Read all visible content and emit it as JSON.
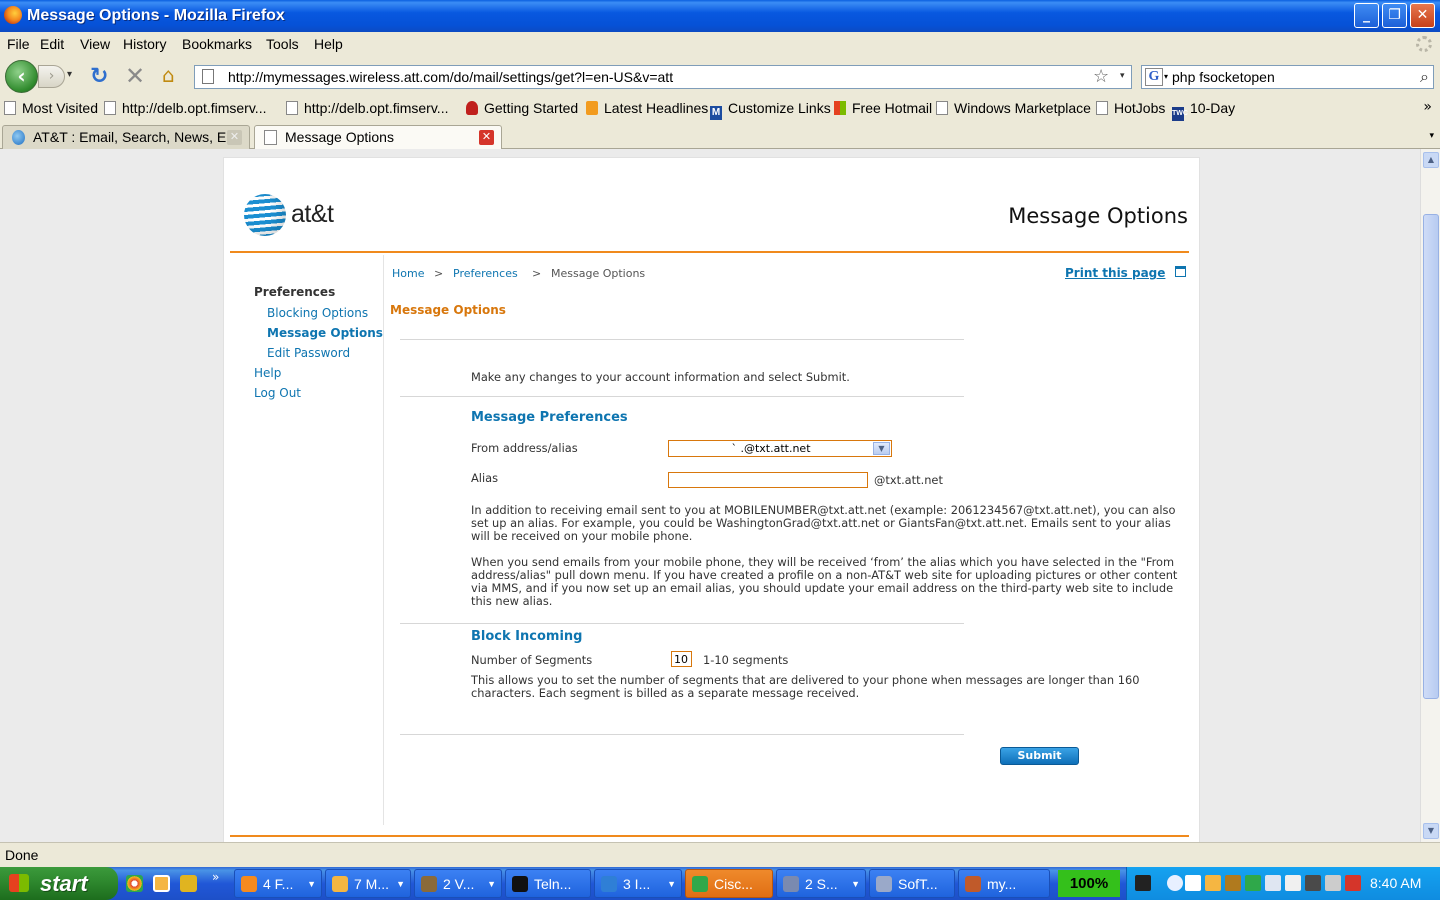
{
  "window": {
    "title": "Message Options - Mozilla Firefox",
    "min_glyph": "_",
    "max_glyph": "❐",
    "close_glyph": "✕"
  },
  "menu": [
    "File",
    "Edit",
    "View",
    "History",
    "Bookmarks",
    "Tools",
    "Help"
  ],
  "nav": {
    "back_glyph": "‹",
    "forward_glyph": "›",
    "dropdown_glyph": "▾",
    "reload_glyph": "↻",
    "stop_glyph": "✕",
    "home_glyph": "⌂",
    "url": "http://mymessages.wireless.att.com/do/mail/settings/get?l=en-US&v=att",
    "star_glyph": "☆",
    "search_engine": "G",
    "search_value": "php fsocketopen",
    "search_glyph": "⌕"
  },
  "bookmarks": [
    {
      "label": "Most Visited",
      "icon": "page-icon"
    },
    {
      "label": "http://delb.opt.fimserv...",
      "icon": "page-icon"
    },
    {
      "label": "http://delb.opt.fimserv...",
      "icon": "page-icon"
    },
    {
      "label": "Getting Started",
      "icon": "firefox-icon"
    },
    {
      "label": "Latest Headlines",
      "icon": "rss-icon"
    },
    {
      "label": "Customize Links",
      "icon": "msn-icon"
    },
    {
      "label": "Free Hotmail",
      "icon": "windows-icon"
    },
    {
      "label": "Windows Marketplace",
      "icon": "page-icon"
    },
    {
      "label": "HotJobs",
      "icon": "page-icon"
    },
    {
      "label": "10-Day",
      "icon": "twc-icon"
    }
  ],
  "bookmarks_more": "»",
  "tabs": [
    {
      "label": "AT&T : Email, Search, News, E...",
      "active": false
    },
    {
      "label": "Message Options",
      "active": true
    }
  ],
  "page": {
    "logo_text": "at&t",
    "title": "Message Options",
    "sidebar": {
      "heading": "Preferences",
      "items": [
        {
          "label": "Blocking Options",
          "current": false
        },
        {
          "label": "Message Options",
          "current": true
        },
        {
          "label": "Edit Password",
          "current": false
        }
      ],
      "help": "Help",
      "logout": "Log Out"
    },
    "breadcrumb": [
      "Home",
      ">",
      "Preferences",
      ">",
      "Message Options"
    ],
    "print_label": "Print this page",
    "section_title": "Message Options",
    "intro": "Make any changes to your account information and select Submit.",
    "message_prefs": {
      "heading": "Message Preferences",
      "from_label": "From address/alias",
      "from_value": "` .@txt.att.net",
      "alias_label": "Alias",
      "alias_value": "",
      "alias_suffix": "@txt.att.net",
      "para1": "In addition to receiving email sent to you at MOBILENUMBER@txt.att.net (example: 2061234567@txt.att.net), you can also set up an alias. For example, you could be WashingtonGrad@txt.att.net or GiantsFan@txt.att.net. Emails sent to your alias will be received on your mobile phone.",
      "para2": "When you send emails from your mobile phone, they will be received ‘from’ the alias which you have selected in the \"From address/alias\" pull down menu. If you have created a profile on a non-AT&T web site for uploading pictures or other content via MMS, and if you now set up an email alias, you should update your email address on the third-party web site to include this new alias."
    },
    "block_incoming": {
      "heading": "Block Incoming",
      "segments_label": "Number of Segments",
      "segments_value": "10",
      "segments_hint": "1-10 segments",
      "para": "This allows you to set the number of segments that are delivered to your phone when messages are longer than 160 characters. Each segment is billed as a separate message received."
    },
    "submit_label": "Submit"
  },
  "status": "Done",
  "taskbar": {
    "start": "start",
    "more": "»",
    "tasks": [
      {
        "label": "4 F...",
        "active": false,
        "color": "#f58a1f"
      },
      {
        "label": "7 M...",
        "active": false,
        "color": "#f5b642"
      },
      {
        "label": "2 V...",
        "active": false,
        "color": "#8a6a3a"
      },
      {
        "label": "Teln...",
        "active": false,
        "color": "#111111"
      },
      {
        "label": "3 I...",
        "active": false,
        "color": "#2f7fd6"
      },
      {
        "label": "Cisc...",
        "active": true,
        "color": "#2fa84a"
      },
      {
        "label": "2 S...",
        "active": false,
        "color": "#7a8ab0"
      },
      {
        "label": "SofT...",
        "active": false,
        "color": "#9aa9c9"
      },
      {
        "label": "my...",
        "active": false,
        "color": "#c05a2a"
      }
    ],
    "zoom": "100%",
    "clock": "8:40 AM"
  }
}
